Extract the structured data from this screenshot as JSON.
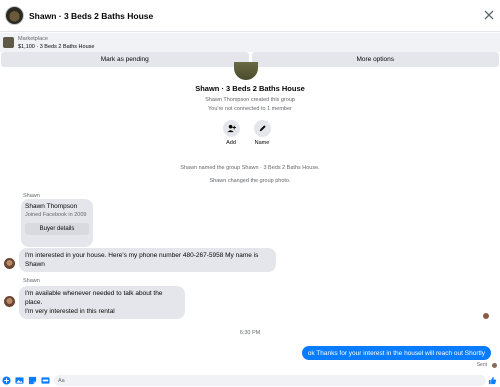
{
  "header": {
    "title": "Shawn · 3 Beds 2 Baths House"
  },
  "marketplace": {
    "label": "Marketplace",
    "listing": "$1,100 · 3 Beds 2 Baths House",
    "mark_pending": "Mark as pending",
    "more_options": "More options"
  },
  "group": {
    "name": "Shawn · 3 Beds 2 Baths House",
    "created_by": "Shawn Thompson created this group",
    "connection": "You're not connected to 1 member",
    "add_label": "Add",
    "name_label": "Name"
  },
  "system_messages": [
    "Shawn named the group Shawn · 3 Beds 2 Baths House.",
    "Shawn changed the group photo."
  ],
  "profile_card": {
    "sender": "Shawn",
    "name": "Shawn Thompson",
    "joined": "Joined Facebook in 2009",
    "button": "Buyer details"
  },
  "messages": [
    {
      "line1": "I'm interested in your house. Here's my phone number 480-267-5958  My name is",
      "line2": "Shawn"
    },
    {
      "sender": "Shawn",
      "line1": "I'm available whenever needed to talk about the place.",
      "line2": "I'm very interested in this rental"
    }
  ],
  "timestamp": "6:30 PM",
  "outgoing": {
    "text": "ok Thanks for your interest in the housel will reach out Shortly",
    "status": "Sent"
  },
  "composer": {
    "placeholder": "Aa"
  },
  "colors": {
    "accent": "#0a7cff",
    "bubble": "#e4e6eb"
  }
}
